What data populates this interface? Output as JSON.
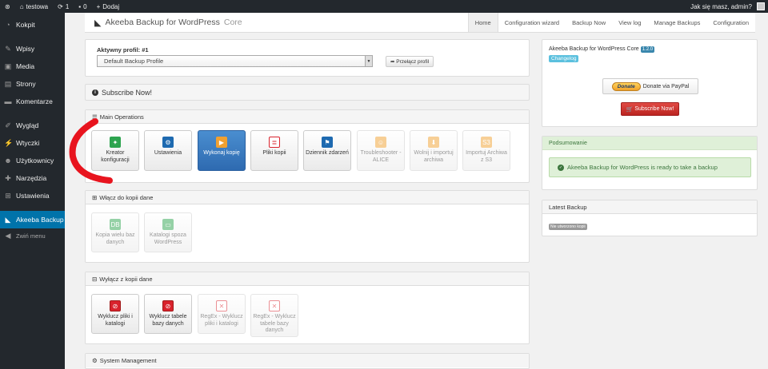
{
  "adminbar": {
    "site_name": "testowa",
    "updates_count": "1",
    "comments_count": "0",
    "add_new": "Dodaj",
    "greeting": "Jak się masz, admin?"
  },
  "sidebar": {
    "items": [
      {
        "label": "Kokpit",
        "icon": "dashboard-icon"
      },
      {
        "label": "Wpisy",
        "icon": "pin-icon"
      },
      {
        "label": "Media",
        "icon": "media-icon"
      },
      {
        "label": "Strony",
        "icon": "page-icon"
      },
      {
        "label": "Komentarze",
        "icon": "comment-icon"
      },
      {
        "label": "Wygląd",
        "icon": "brush-icon"
      },
      {
        "label": "Wtyczki",
        "icon": "plugin-icon"
      },
      {
        "label": "Użytkownicy",
        "icon": "user-icon"
      },
      {
        "label": "Narzędzia",
        "icon": "wrench-icon"
      },
      {
        "label": "Ustawienia",
        "icon": "settings-icon"
      },
      {
        "label": "Akeeba Backup",
        "icon": "akeeba-icon"
      }
    ],
    "collapse_label": "Zwiń menu"
  },
  "header": {
    "brand": "Akeeba Backup for WordPress",
    "brand_suffix": "Core",
    "nav": [
      "Home",
      "Configuration wizard",
      "Backup Now",
      "View log",
      "Manage Backups",
      "Configuration"
    ]
  },
  "profile": {
    "label": "Aktywny profil: #1",
    "selected": "Default Backup Profile",
    "switch_button": "Przełącz profil"
  },
  "subscribe_bar": "Subscribe Now!",
  "main_operations": {
    "title": "Main Operations",
    "tiles": [
      {
        "label": "Kreator konfiguracji"
      },
      {
        "label": "Ustawienia"
      },
      {
        "label": "Wykonaj kopię"
      },
      {
        "label": "Pliki kopii"
      },
      {
        "label": "Dziennik zdarzeń"
      },
      {
        "label": "Troubleshooter - ALICE"
      },
      {
        "label": "Wolnij i importuj archiwa"
      },
      {
        "label": "Importuj Archiwa z S3"
      }
    ]
  },
  "include_panel": {
    "title": "Włącz do kopii dane",
    "tiles": [
      {
        "label": "Kopia wielu baz danych"
      },
      {
        "label": "Katalogi spoza WordPress"
      }
    ]
  },
  "exclude_panel": {
    "title": "Wyłącz z kopii dane",
    "tiles": [
      {
        "label": "Wyklucz pliki i katalogi"
      },
      {
        "label": "Wyklucz tabele bazy danych"
      },
      {
        "label": "RegEx - Wyklucz pliki i katalogi"
      },
      {
        "label": "RegEx - Wyklucz tabele bazy danych"
      }
    ]
  },
  "system_management": {
    "title": "System Management"
  },
  "info_panel": {
    "title": "Akeeba Backup for WordPress Core",
    "version": "1.2.0",
    "changelog": "Changelog",
    "donate_badge": "Donate",
    "paypal_label": "Donate via PayPal",
    "subscribe_button": "Subscribe Now!"
  },
  "summary_panel": {
    "title": "Podsumowanie",
    "message": "Akeeba Backup for WordPress is ready to take a backup"
  },
  "latest_backup": {
    "title": "Latest Backup",
    "badge": "Nie utworzono kopii"
  },
  "colors": {
    "sidebar_bg": "#23282d",
    "active_menu": "#0073aa",
    "primary_tile": "#2e6ab0",
    "danger": "#d9232d",
    "success_bg": "#dff0d8"
  }
}
